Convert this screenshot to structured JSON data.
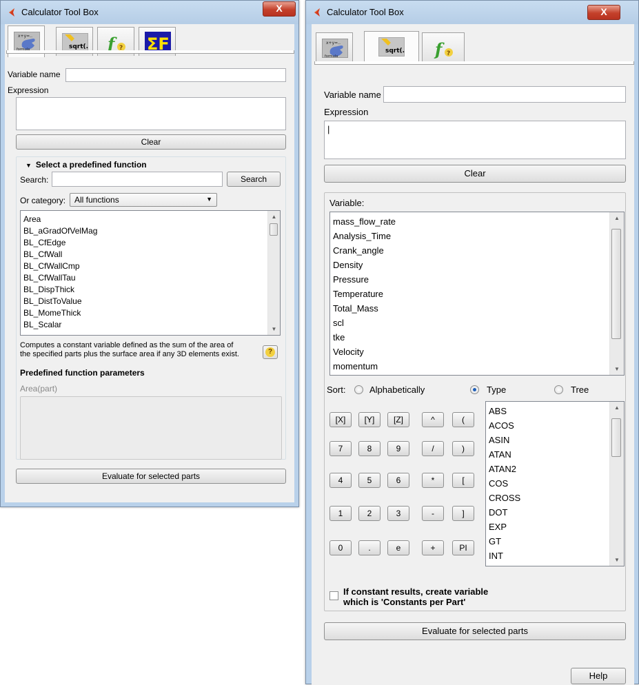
{
  "left_window": {
    "title": "Calculator Tool Box",
    "close_label": "X",
    "tabs": [
      {
        "name": "formula",
        "caption": "formula",
        "active": true
      },
      {
        "name": "sqrt",
        "caption": "sqrt(..",
        "active": false
      },
      {
        "name": "function-help",
        "caption": "f",
        "active": false
      },
      {
        "name": "sum",
        "caption": "ΣF",
        "active": false
      }
    ],
    "variable_name_label": "Variable name",
    "variable_name_value": "",
    "expression_label": "Expression",
    "expression_value": "",
    "clear_label": "Clear",
    "predefined_header": "Select a predefined function",
    "search_label": "Search:",
    "search_value": "",
    "search_button": "Search",
    "category_label": "Or category:",
    "category_value": "All functions",
    "functions": [
      "Area",
      "BL_aGradOfVelMag",
      "BL_CfEdge",
      "BL_CfWall",
      "BL_CfWallCmp",
      "BL_CfWallTau",
      "BL_DispThick",
      "BL_DistToValue",
      "BL_MomeThick",
      "BL_Scalar"
    ],
    "description_line1": "Computes a constant variable defined as the sum of the area of",
    "description_line2": "the specified parts plus the surface area if any 3D elements exist.",
    "help_icon_label": "?",
    "params_title": "Predefined function parameters",
    "params_signature": "Area(part)",
    "evaluate_label": "Evaluate for selected parts"
  },
  "right_window": {
    "title": "Calculator Tool Box",
    "close_label": "X",
    "tabs": [
      {
        "name": "formula",
        "caption": "formula",
        "active": false
      },
      {
        "name": "sqrt",
        "caption": "sqrt(..",
        "active": true
      },
      {
        "name": "function-help",
        "caption": "f",
        "active": false
      }
    ],
    "variable_name_label": "Variable name",
    "variable_name_value": "",
    "expression_label": "Expression",
    "expression_value": "|",
    "clear_label": "Clear",
    "variable_label": "Variable:",
    "variables": [
      "mass_flow_rate",
      "Analysis_Time",
      "Crank_angle",
      "Density",
      "Pressure",
      "Temperature",
      "Total_Mass",
      "scl",
      "tke",
      "Velocity",
      "momentum"
    ],
    "sort_label": "Sort:",
    "sort_options": [
      {
        "label": "Alphabetically",
        "selected": false
      },
      {
        "label": "Type",
        "selected": true
      },
      {
        "label": "Tree",
        "selected": false
      }
    ],
    "keypad": [
      [
        "[X]",
        "[Y]",
        "[Z]",
        "^",
        "("
      ],
      [
        "7",
        "8",
        "9",
        "/",
        ")"
      ],
      [
        "4",
        "5",
        "6",
        "*",
        "["
      ],
      [
        "1",
        "2",
        "3",
        "-",
        "]"
      ],
      [
        "0",
        ".",
        "e",
        "+",
        "PI"
      ]
    ],
    "operators": [
      "ABS",
      "ACOS",
      "ASIN",
      "ATAN",
      "ATAN2",
      "COS",
      "CROSS",
      "DOT",
      "EXP",
      "GT",
      "INT"
    ],
    "constants_checkbox_line1": "If constant results, create variable",
    "constants_checkbox_line2": "which is 'Constants per Part'",
    "constants_checked": false,
    "evaluate_label": "Evaluate for selected parts",
    "help_label": "Help"
  },
  "colors": {
    "frame": "#b9d1ea",
    "client": "#f0f0f0",
    "close_red": "#c4412b",
    "radio_dot": "#1f5fb8"
  }
}
